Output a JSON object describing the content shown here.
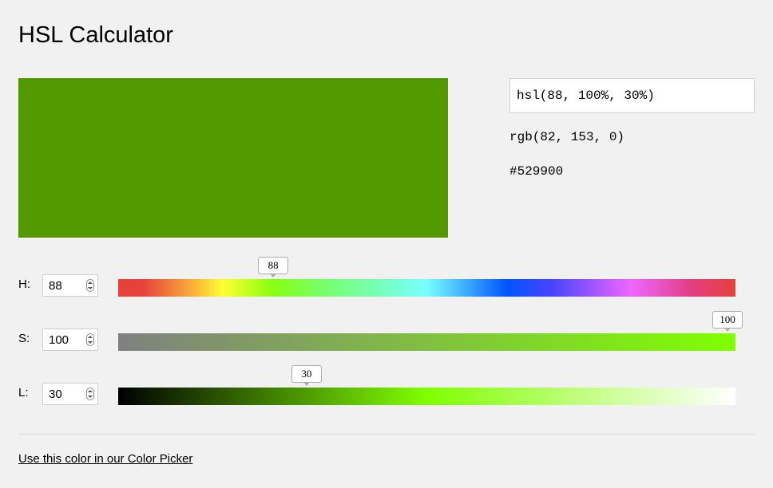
{
  "page": {
    "title": "HSL Calculator"
  },
  "color": {
    "swatch_color": "#529900",
    "hsl_value": "hsl(88, 100%, 30%)",
    "rgb_text": "rgb(82, 153, 0)",
    "hex_text": "#529900"
  },
  "sliders": {
    "h": {
      "label": "H:",
      "value": "88",
      "min": 0,
      "max": 360
    },
    "s": {
      "label": "S:",
      "value": "100",
      "min": 0,
      "max": 100
    },
    "l": {
      "label": "L:",
      "value": "30",
      "min": 0,
      "max": 100
    }
  },
  "footer": {
    "link_text": "Use this color in our Color Picker"
  }
}
